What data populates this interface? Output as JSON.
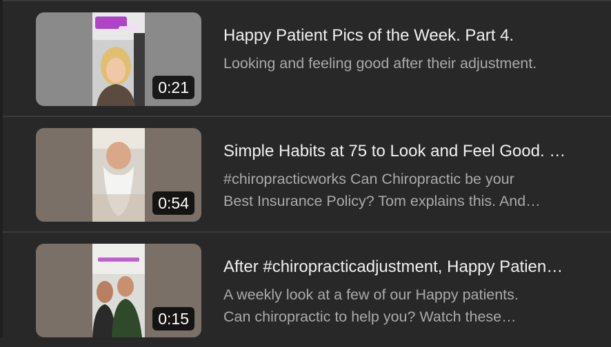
{
  "videos": [
    {
      "title": "Happy Patient Pics of the Week. Part 4.",
      "desc1": "Looking and feeling good after their adjustment.",
      "desc2": "",
      "duration": "0:21"
    },
    {
      "title": "Simple Habits at 75 to Look and Feel Good. …",
      "desc1": "#chiropracticworks Can Chiropractic be your",
      "desc2": "Best Insurance Policy? Tom explains this. And…",
      "duration": "0:54"
    },
    {
      "title": "After #chiropracticadjustment, Happy Patien…",
      "desc1": "A weekly look at a few of our Happy patients.",
      "desc2": "Can chiropractic to help you? Watch these…",
      "duration": "0:15"
    }
  ]
}
